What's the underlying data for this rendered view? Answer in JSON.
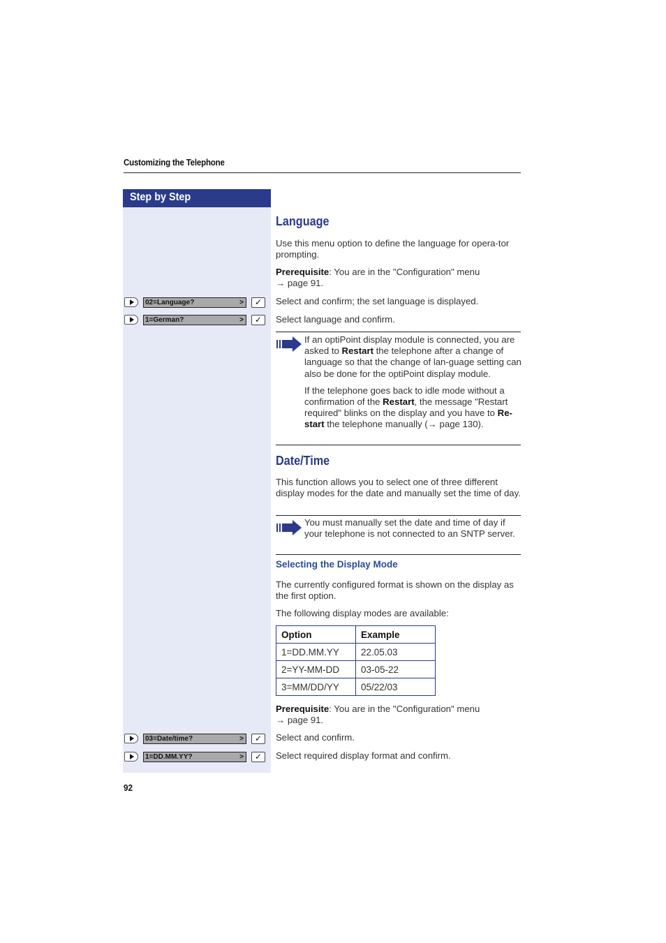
{
  "running_head": "Customizing the Telephone",
  "sidebar_title": "Step by Step",
  "page_number": "92",
  "language": {
    "heading": "Language",
    "intro": "Use this menu option to define the language for opera-tor prompting.",
    "prereq_label": "Prerequisite",
    "prereq_text": ": You are in the \"Configuration\" menu",
    "prereq_ref": "→ page 91.",
    "steps": [
      {
        "display": "02=Language?",
        "arrow": ">",
        "ok": "✓",
        "text": "Select and confirm; the set language is displayed."
      },
      {
        "display": "1=German?",
        "arrow": ">",
        "ok": "✓",
        "text": "Select language and confirm."
      }
    ],
    "note": {
      "p1_a": "If an optiPoint display module is connected, you are asked to ",
      "p1_bold": "Restart",
      "p1_b": " the telephone after a change of language so that the change of lan-guage setting can also be done for the optiPoint display module.",
      "p2_a": "If the telephone goes back to idle mode without a confirmation of the ",
      "p2_bold1": "Restart",
      "p2_b": ", the message \"Restart required\" blinks on the display and you have to ",
      "p2_bold2": "Re-start",
      "p2_c": " the telephone manually (→ page 130)."
    }
  },
  "datetime": {
    "heading": "Date/Time",
    "intro": "This function allows you to select one of three different display modes for the date and manually set the time of day.",
    "note": "You must manually set the date and time of day if your telephone is not connected to an SNTP server.",
    "sub_heading": "Selecting the Display Mode",
    "para1": "The currently configured format is shown on the display as the first option.",
    "para2": "The following display modes are available:",
    "table": {
      "headers": [
        "Option",
        "Example"
      ],
      "rows": [
        [
          "1=DD.MM.YY",
          "22.05.03"
        ],
        [
          "2=YY-MM-DD",
          "03-05-22"
        ],
        [
          "3=MM/DD/YY",
          "05/22/03"
        ]
      ]
    },
    "prereq_label": "Prerequisite",
    "prereq_text": ": You are in the \"Configuration\" menu",
    "prereq_ref": "→ page 91.",
    "steps": [
      {
        "display": "03=Date/time?",
        "arrow": ">",
        "ok": "✓",
        "text": "Select and confirm."
      },
      {
        "display": "1=DD.MM.YY?",
        "arrow": ">",
        "ok": "✓",
        "text": "Select required display format and confirm."
      }
    ]
  },
  "colors": {
    "accent": "#2b3a8a",
    "sidebar_bg": "#e6eaf6",
    "display_bg": "#a9a9a9"
  }
}
